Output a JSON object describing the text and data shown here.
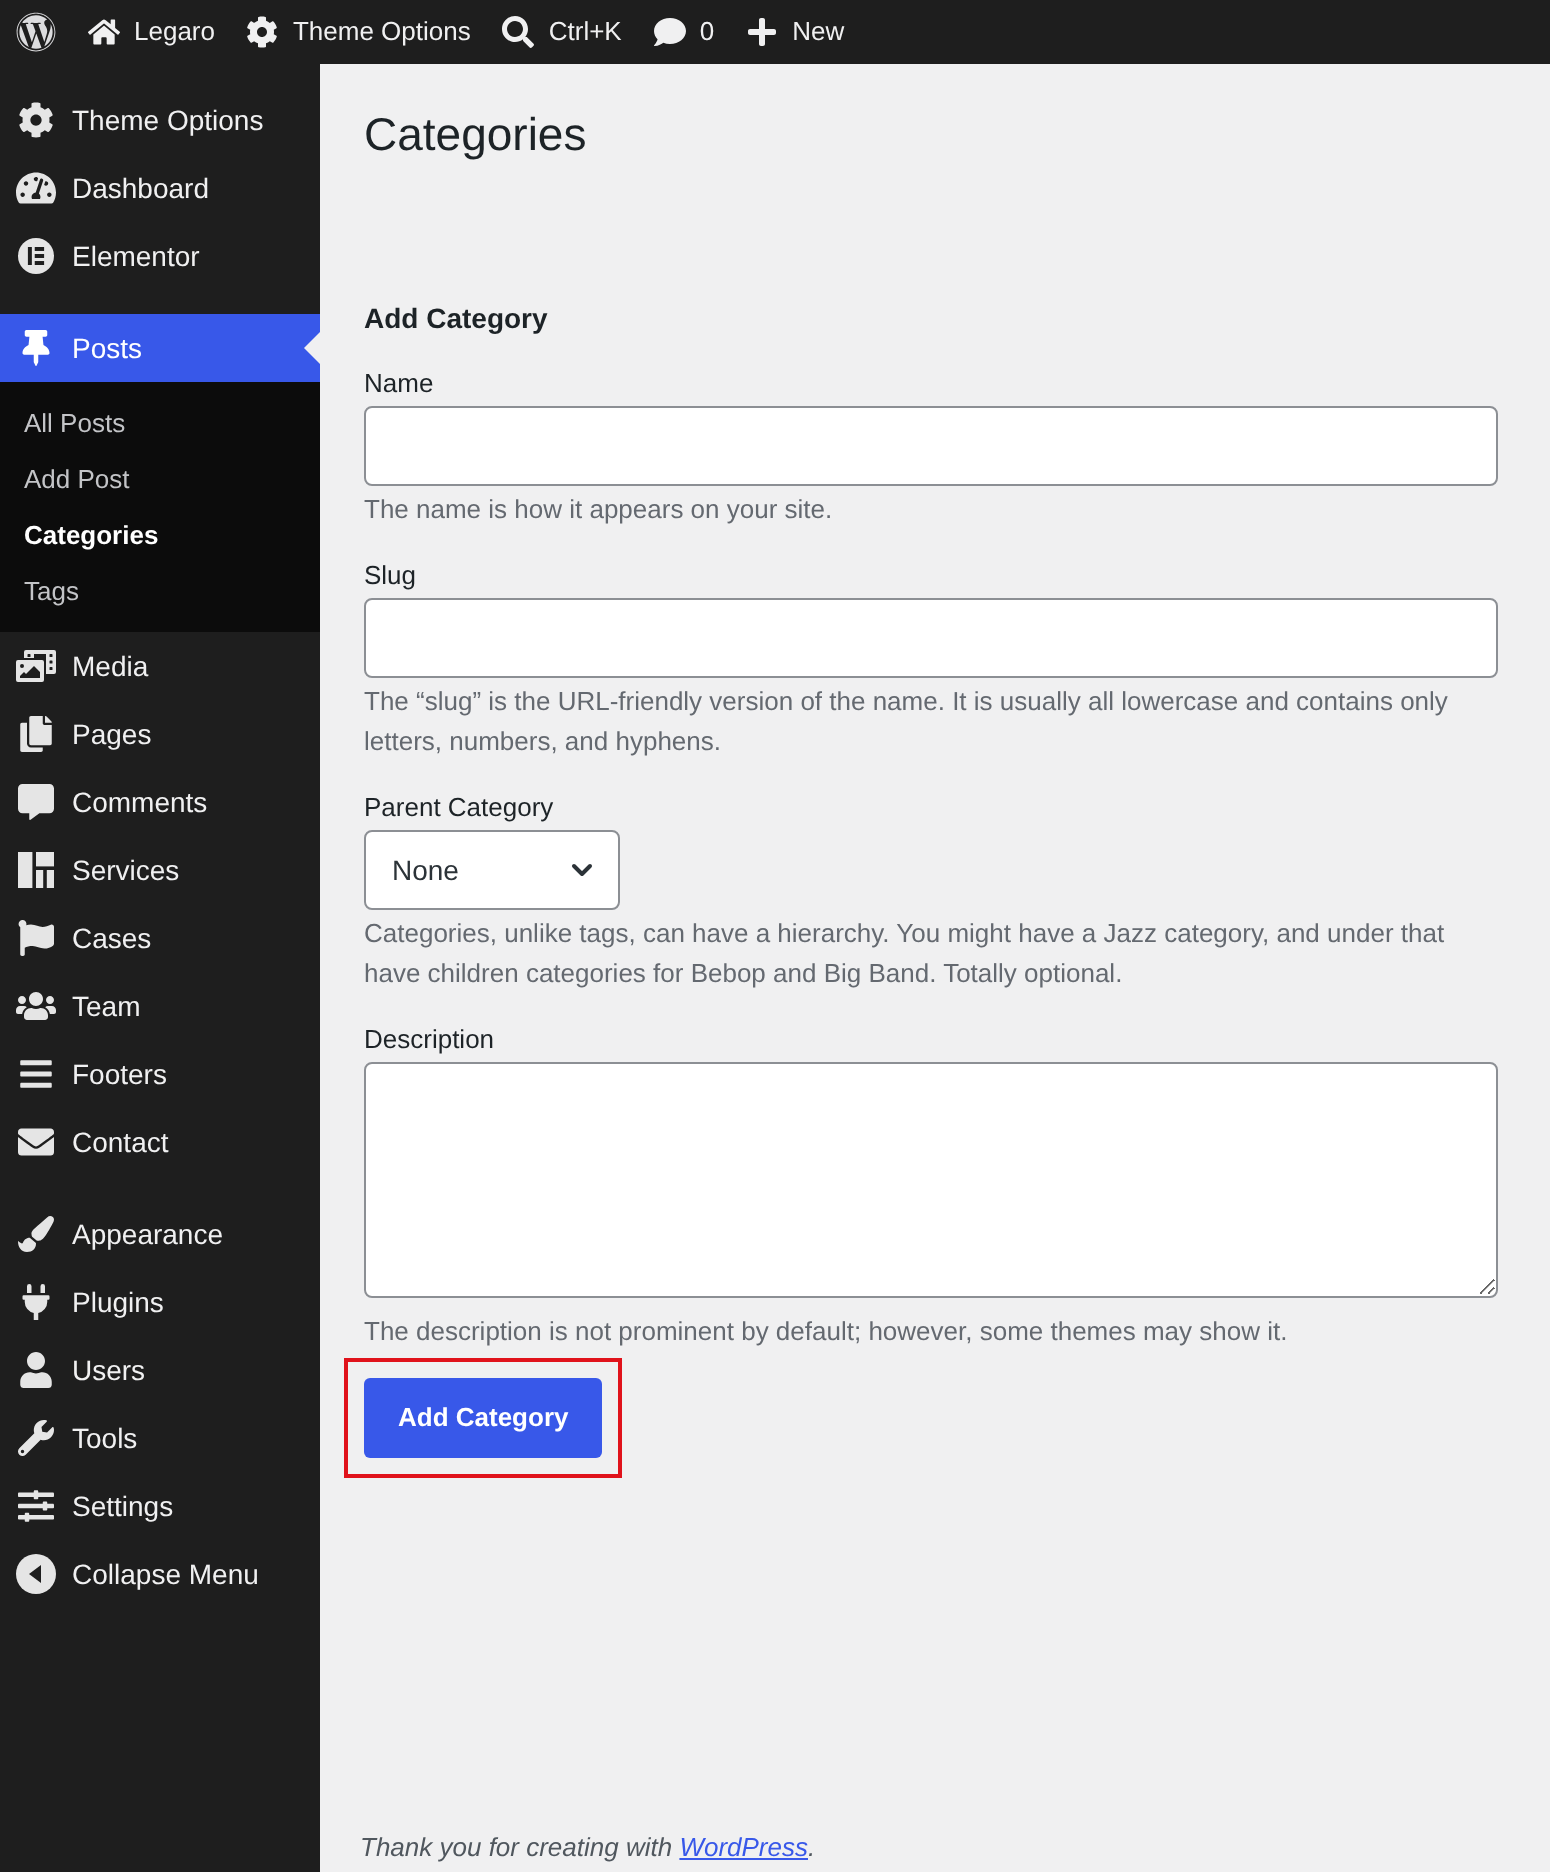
{
  "admin_bar": {
    "items": [
      {
        "label": "Legaro"
      },
      {
        "label": "Theme Options"
      },
      {
        "label": "Ctrl+K"
      },
      {
        "label": "0"
      },
      {
        "label": "New"
      }
    ]
  },
  "sidebar": {
    "groups": [
      {
        "items": [
          {
            "label": "Theme Options",
            "selected": false
          },
          {
            "label": "Dashboard",
            "selected": false
          },
          {
            "label": "Elementor",
            "selected": false
          }
        ]
      },
      {
        "items": [
          {
            "label": "Posts",
            "selected": true,
            "children": [
              {
                "label": "All Posts",
                "selected": false
              },
              {
                "label": "Add Post",
                "selected": false
              },
              {
                "label": "Categories",
                "selected": true
              },
              {
                "label": "Tags",
                "selected": false
              }
            ]
          },
          {
            "label": "Media",
            "selected": false
          },
          {
            "label": "Pages",
            "selected": false
          },
          {
            "label": "Comments",
            "selected": false
          },
          {
            "label": "Services",
            "selected": false
          },
          {
            "label": "Cases",
            "selected": false
          },
          {
            "label": "Team",
            "selected": false
          },
          {
            "label": "Footers",
            "selected": false
          },
          {
            "label": "Contact",
            "selected": false
          }
        ]
      },
      {
        "items": [
          {
            "label": "Appearance",
            "selected": false
          },
          {
            "label": "Plugins",
            "selected": false
          },
          {
            "label": "Users",
            "selected": false
          },
          {
            "label": "Tools",
            "selected": false
          },
          {
            "label": "Settings",
            "selected": false
          }
        ]
      }
    ],
    "collapse_button": {
      "label": "Collapse Menu"
    }
  },
  "page_title": "Categories",
  "form": {
    "title": "Add Category",
    "fields": [
      {
        "kind": "text",
        "label": "Name",
        "hint": "The name is how it appears on your site."
      },
      {
        "kind": "text",
        "label": "Slug",
        "hint": "The “slug” is the URL-friendly version of the name. It is usually all lowercase and contains only letters, numbers, and hyphens."
      },
      {
        "kind": "select",
        "label": "Parent Category",
        "value": "None",
        "hint": "Categories, unlike tags, can have a hierarchy. You might have a Jazz category, and under that have children categories for Bebop and Big Band. Totally optional."
      },
      {
        "kind": "textarea",
        "label": "Description",
        "hint": "The description is not prominent by default; however, some themes may show it."
      }
    ],
    "submit": {
      "label": "Add Category",
      "highlighted": true
    }
  },
  "footer": {
    "text": "Thank you for creating with",
    "link": "WordPress",
    "text_after": "."
  }
}
